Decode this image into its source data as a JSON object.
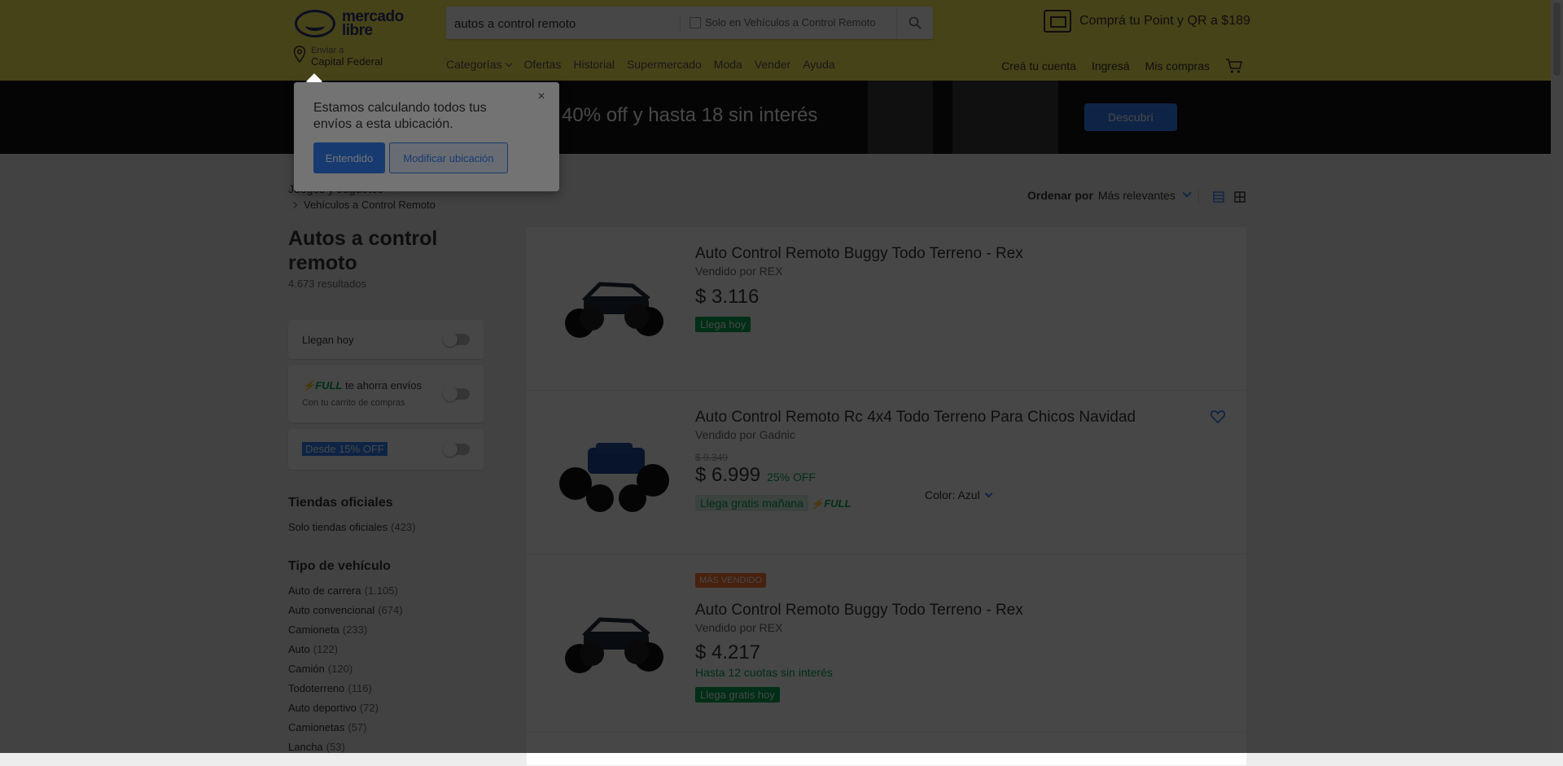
{
  "header": {
    "logo_text": "mercado\nlibre",
    "search_value": "autos a control remoto",
    "search_filter_label": "Solo en Vehículos a Control Remoto",
    "promo_text": "Comprá tu Point y QR a $189",
    "location_label": "Enviar a",
    "location_city": "Capital Federal",
    "nav": [
      "Categorías",
      "Ofertas",
      "Historial",
      "Supermercado",
      "Moda",
      "Vender",
      "Ayuda"
    ],
    "account": [
      "Creá tu cuenta",
      "Ingresá",
      "Mis compras"
    ]
  },
  "banner": {
    "text": "a 40% off y hasta 18 sin interés",
    "button": "Descubrí"
  },
  "popup": {
    "message": "Estamos calculando todos tus envíos a esta ubicación.",
    "primary": "Entendido",
    "secondary": "Modificar ubicación",
    "close": "×"
  },
  "breadcrumb": {
    "parent": "Juegos y Juguetes",
    "current": "Vehículos a Control Remoto"
  },
  "page": {
    "title": "Autos a control remoto",
    "results": "4.673 resultados"
  },
  "quick_filters": {
    "today": "Llegan hoy",
    "full_word": "FULL",
    "full_text": " te ahorra envíos",
    "full_sub": "Con tu carrito de compras",
    "discount": "Desde 15% OFF"
  },
  "stores": {
    "heading": "Tiendas oficiales",
    "items": [
      {
        "label": "Solo tiendas oficiales",
        "qty": "(423)"
      }
    ]
  },
  "vehicle_type": {
    "heading": "Tipo de vehículo",
    "items": [
      {
        "label": "Auto de carrera",
        "qty": "(1.105)"
      },
      {
        "label": "Auto convencional",
        "qty": "(674)"
      },
      {
        "label": "Camioneta",
        "qty": "(233)"
      },
      {
        "label": "Auto",
        "qty": "(122)"
      },
      {
        "label": "Camión",
        "qty": "(120)"
      },
      {
        "label": "Todoterreno",
        "qty": "(116)"
      },
      {
        "label": "Auto deportivo",
        "qty": "(72)"
      },
      {
        "label": "Camionetas",
        "qty": "(57)"
      },
      {
        "label": "Lancha",
        "qty": "(53)"
      }
    ]
  },
  "sort": {
    "label": "Ordenar por",
    "value": "Más relevantes"
  },
  "items": [
    {
      "title": "Auto Control Remoto Buggy Todo Terreno - Rex",
      "seller": "Vendido por REX",
      "price": "$ 3.116",
      "shipping": "Llega hoy"
    },
    {
      "title": "Auto Control Remoto Rc 4x4 Todo Terreno Para Chicos Navidad",
      "seller": "Vendido por Gadnic",
      "old_price": "$ 9.349",
      "price": "$ 6.999",
      "discount": "25% OFF",
      "shipping": "Llega gratis mañana",
      "full": "FULL",
      "color": "Color: Azul"
    },
    {
      "badge": "MÁS VENDIDO",
      "title": "Auto Control Remoto Buggy Todo Terreno - Rex",
      "seller": "Vendido por REX",
      "price": "$ 4.217",
      "installments": "Hasta 12 cuotas sin interés",
      "shipping": "Llega gratis hoy"
    }
  ],
  "colors": {
    "header": "#fff159",
    "brand_blue": "#3483fa",
    "green": "#00a650",
    "best_seller": "#ff7733"
  }
}
